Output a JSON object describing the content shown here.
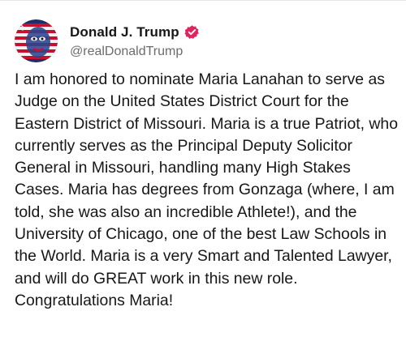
{
  "post": {
    "author": {
      "display_name": "Donald J. Trump",
      "handle": "@realDonaldTrump",
      "verified_icon": "verified-badge-icon",
      "badge_color": "#e0245e"
    },
    "text": "I am honored to nominate Maria Lanahan to serve as Judge on the United States District Court for the Eastern District of Missouri. Maria is a true Patriot, who currently serves as the Principal Deputy Solicitor General in Missouri, handling many High Stakes Cases. Maria has degrees from Gonzaga (where, I am told, she was also an incredible Athlete!), and the University of Chicago, one of the best Law Schools in the World. Maria is a very Smart and Talented Lawyer, and will do GREAT work in this new role. Congratulations Maria!"
  }
}
